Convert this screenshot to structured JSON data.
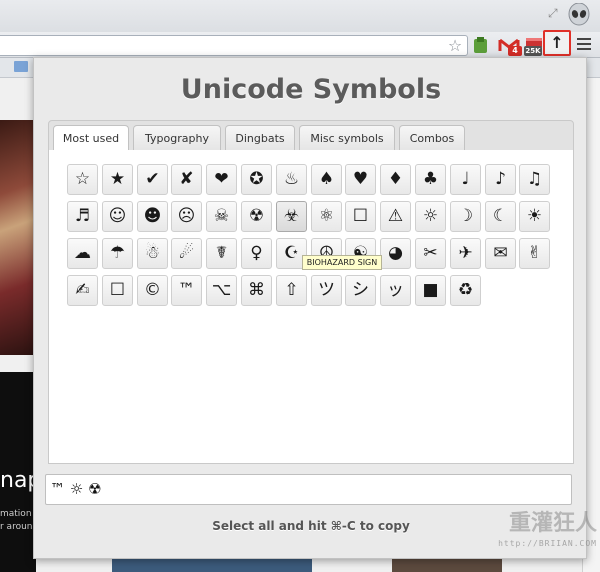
{
  "browser": {
    "bookmark_star_icon": "star-outline-icon",
    "extensions": [
      {
        "name": "green-extension-icon"
      },
      {
        "name": "gmail-icon",
        "badge": "4"
      },
      {
        "name": "counter-icon",
        "badge": "25K"
      },
      {
        "name": "unicode-extension-icon",
        "glyph": "↑",
        "highlight_color": "#e03028"
      }
    ]
  },
  "background_page": {
    "headline_fragment": "nap",
    "sub_fragment_1": "mation",
    "sub_fragment_2": "r aroun"
  },
  "popup": {
    "title": "Unicode Symbols",
    "tabs": [
      {
        "label": "Most used",
        "active": true
      },
      {
        "label": "Typography",
        "active": false
      },
      {
        "label": "Dingbats",
        "active": false
      },
      {
        "label": "Misc symbols",
        "active": false
      },
      {
        "label": "Combos",
        "active": false
      }
    ],
    "symbols": [
      "☆",
      "★",
      "✔",
      "✘",
      "❤",
      "✪",
      "♨",
      "♠",
      "♥",
      "♦",
      "♣",
      "♩",
      "♪",
      "♫",
      "♬",
      "☺",
      "☻",
      "☹",
      "☠",
      "☢",
      "☣",
      "⚛",
      "☐",
      "⚠",
      "☼",
      "☽",
      "☾",
      "☀",
      "☁",
      "☂",
      "☃",
      "☄",
      "☤",
      "♀",
      "☪",
      "☮",
      "☯",
      "◕",
      "✂",
      "✈",
      "✉",
      "✌",
      "✍",
      "☐",
      "©",
      "™",
      "⌥",
      "⌘",
      "⇧",
      "ツ",
      "シ",
      "ッ",
      "■",
      "♻"
    ],
    "hovered_index": 20,
    "tooltip": "BIOHAZARD SIGN",
    "output_value": "™ ☼ ☢",
    "hint": "Select all and hit ⌘-C to copy",
    "watermark_text": "重灌狂人",
    "watermark_url": "http://BRIIAN.COM"
  },
  "colors": {
    "popup_bg": "#eaeaea",
    "title": "#5b5b5b",
    "tooltip_bg": "#fffecc",
    "highlight": "#e03028"
  }
}
